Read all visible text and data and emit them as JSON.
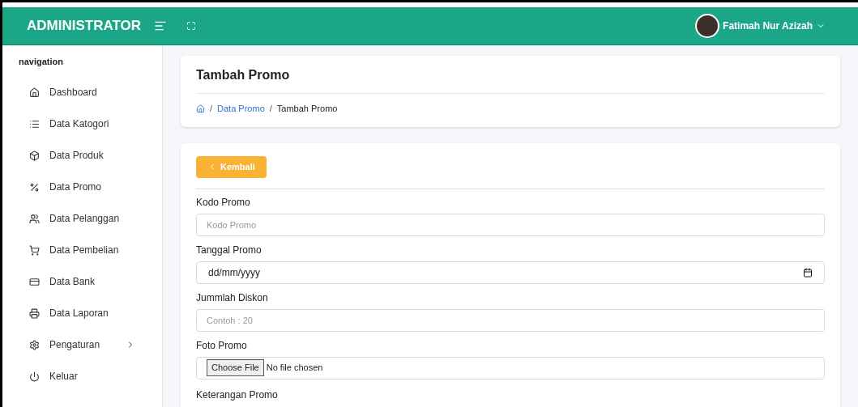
{
  "header": {
    "brand": "ADMINISTRATOR",
    "user_name": "Fatimah Nur Azizah"
  },
  "sidebar": {
    "heading": "navigation",
    "items": [
      {
        "label": "Dashboard",
        "has_submenu": false
      },
      {
        "label": "Data Katogori",
        "has_submenu": false
      },
      {
        "label": "Data Produk",
        "has_submenu": false
      },
      {
        "label": "Data Promo",
        "has_submenu": false
      },
      {
        "label": "Data Pelanggan",
        "has_submenu": false
      },
      {
        "label": "Data Pembelian",
        "has_submenu": false
      },
      {
        "label": "Data Bank",
        "has_submenu": false
      },
      {
        "label": "Data Laporan",
        "has_submenu": false
      },
      {
        "label": "Pengaturan",
        "has_submenu": true
      },
      {
        "label": "Keluar",
        "has_submenu": false
      }
    ]
  },
  "page": {
    "title": "Tambah Promo",
    "breadcrumb": [
      {
        "separator": "/",
        "label": "Data Promo",
        "link": true
      },
      {
        "separator": "/",
        "label": "Tambah Promo",
        "link": false
      }
    ]
  },
  "form": {
    "back_button": "Kembali",
    "fields": [
      {
        "label": "Kodo Promo",
        "kind": "text",
        "placeholder": "Kodo Promo"
      },
      {
        "label": "Tanggal Promo",
        "kind": "date",
        "value": "dd/mm/yyyy"
      },
      {
        "label": "Jummlah Diskon",
        "kind": "text",
        "placeholder": "Contoh : 20"
      },
      {
        "label": "Foto Promo",
        "kind": "file",
        "button": "Choose File",
        "value": "No file chosen"
      },
      {
        "label": "Keterangan Promo",
        "kind": "label"
      }
    ]
  }
}
